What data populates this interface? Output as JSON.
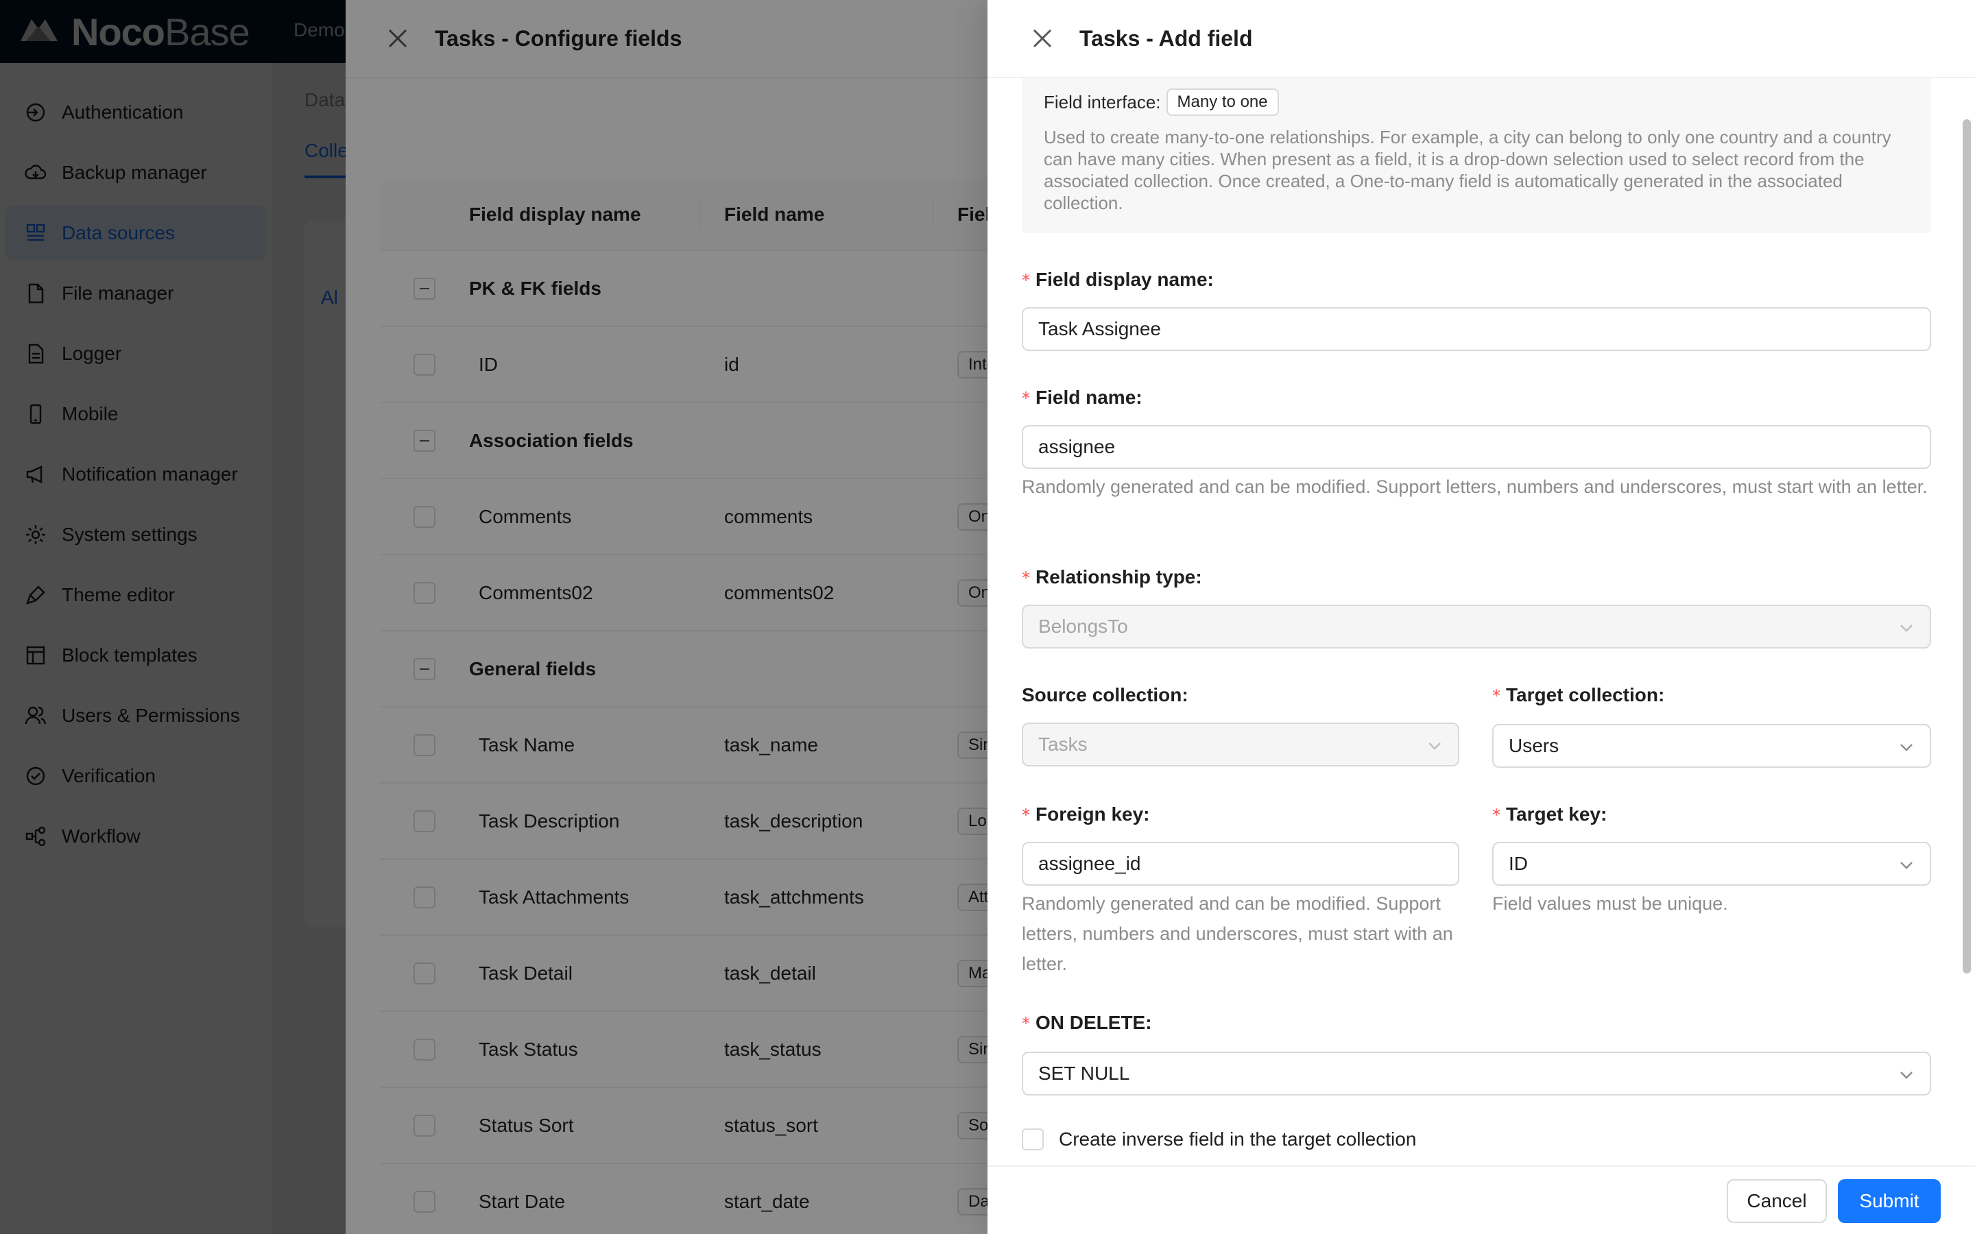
{
  "app": {
    "logo_bold": "Noco",
    "logo_light": "Base",
    "top_menu": "Demo"
  },
  "sidebar": {
    "items": [
      {
        "label": "Authentication",
        "icon": "login-icon"
      },
      {
        "label": "Backup manager",
        "icon": "cloud-icon"
      },
      {
        "label": "Data sources",
        "icon": "database-icon",
        "active": true
      },
      {
        "label": "File manager",
        "icon": "file-icon"
      },
      {
        "label": "Logger",
        "icon": "file-text-icon"
      },
      {
        "label": "Mobile",
        "icon": "mobile-icon"
      },
      {
        "label": "Notification manager",
        "icon": "megaphone-icon"
      },
      {
        "label": "System settings",
        "icon": "gear-icon"
      },
      {
        "label": "Theme editor",
        "icon": "brush-icon"
      },
      {
        "label": "Block templates",
        "icon": "layout-icon"
      },
      {
        "label": "Users & Permissions",
        "icon": "users-icon"
      },
      {
        "label": "Verification",
        "icon": "check-circle-icon"
      },
      {
        "label": "Workflow",
        "icon": "workflow-icon"
      }
    ]
  },
  "background": {
    "breadcrumb": "Data",
    "tab": "Colle",
    "card_tab": "Al"
  },
  "configure_drawer": {
    "title": "Tasks - Configure fields",
    "columns": [
      "Field display name",
      "Field name",
      "Field in"
    ],
    "rows": [
      {
        "group": "PK & FK fields"
      },
      {
        "display": "ID",
        "name": "id",
        "interface": "Intege"
      },
      {
        "group": "Association fields"
      },
      {
        "display": "Comments",
        "name": "comments",
        "interface": "One to"
      },
      {
        "display": "Comments02",
        "name": "comments02",
        "interface": "One to"
      },
      {
        "group": "General fields"
      },
      {
        "display": "Task Name",
        "name": "task_name",
        "interface": "Single"
      },
      {
        "display": "Task Description",
        "name": "task_description",
        "interface": "Long t"
      },
      {
        "display": "Task Attachments",
        "name": "task_attchments",
        "interface": "Attach"
      },
      {
        "display": "Task Detail",
        "name": "task_detail",
        "interface": "Markd"
      },
      {
        "display": "Task Status",
        "name": "task_status",
        "interface": "Single"
      },
      {
        "display": "Status Sort",
        "name": "status_sort",
        "interface": "Sort"
      },
      {
        "display": "Start Date",
        "name": "start_date",
        "interface": "Dateti"
      }
    ]
  },
  "add_field_drawer": {
    "title": "Tasks - Add field",
    "field_interface_label": "Field interface:",
    "field_interface_value": "Many to one",
    "description": "Used to create many-to-one relationships. For example, a city can belong to only one country and a country can have many cities. When present as a field, it is a drop-down selection used to select record from the associated collection. Once created, a One-to-many field is automatically generated in the associated collection.",
    "required_mark": "*",
    "display_name": {
      "label": "Field display name",
      "value": "Task Assignee"
    },
    "field_name": {
      "label": "Field name",
      "value": "assignee",
      "help": "Randomly generated and can be modified. Support letters, numbers and underscores, must start with an letter."
    },
    "relationship_type": {
      "label": "Relationship type",
      "value": "BelongsTo"
    },
    "source_collection": {
      "label": "Source collection",
      "value": "Tasks"
    },
    "target_collection": {
      "label": "Target collection",
      "value": "Users"
    },
    "foreign_key": {
      "label": "Foreign key",
      "value": "assignee_id",
      "help": "Randomly generated and can be modified. Support letters, numbers and underscores, must start with an letter."
    },
    "target_key": {
      "label": "Target key",
      "value": "ID",
      "help": "Field values must be unique."
    },
    "on_delete": {
      "label": "ON DELETE",
      "value": "SET NULL"
    },
    "label_suffix": ":",
    "inverse_checkbox": "Create inverse field in the target collection",
    "cancel": "Cancel",
    "submit": "Submit"
  },
  "colors": {
    "primary": "#1677ff",
    "header_bg": "#001529",
    "required": "#ff4d4f"
  }
}
